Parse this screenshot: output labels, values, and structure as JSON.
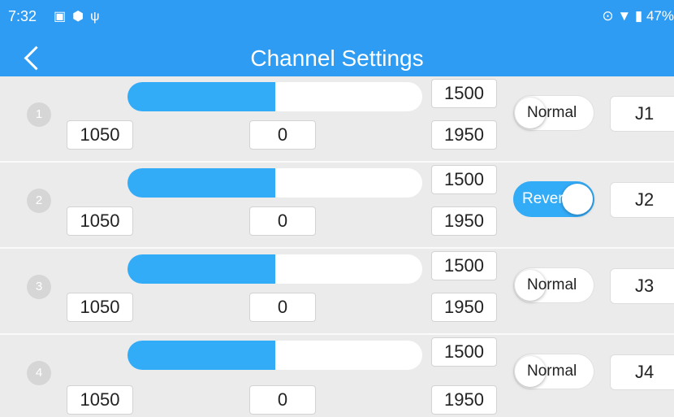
{
  "status_bar": {
    "time": "7:32",
    "battery": "47%"
  },
  "title_bar": {
    "title": "Channel Settings"
  },
  "channels": [
    {
      "index": "1",
      "level_fraction": 0.5,
      "min": "1050",
      "center": "0",
      "value": "1500",
      "max": "1950",
      "mode": "Normal",
      "reversed": false,
      "mapping": "J1"
    },
    {
      "index": "2",
      "level_fraction": 0.5,
      "min": "1050",
      "center": "0",
      "value": "1500",
      "max": "1950",
      "mode": "Reverse",
      "reversed": true,
      "mapping": "J2"
    },
    {
      "index": "3",
      "level_fraction": 0.5,
      "min": "1050",
      "center": "0",
      "value": "1500",
      "max": "1950",
      "mode": "Normal",
      "reversed": false,
      "mapping": "J3"
    },
    {
      "index": "4",
      "level_fraction": 0.5,
      "min": "1050",
      "center": "0",
      "value": "1500",
      "max": "1950",
      "mode": "Normal",
      "reversed": false,
      "mapping": "J4"
    }
  ]
}
